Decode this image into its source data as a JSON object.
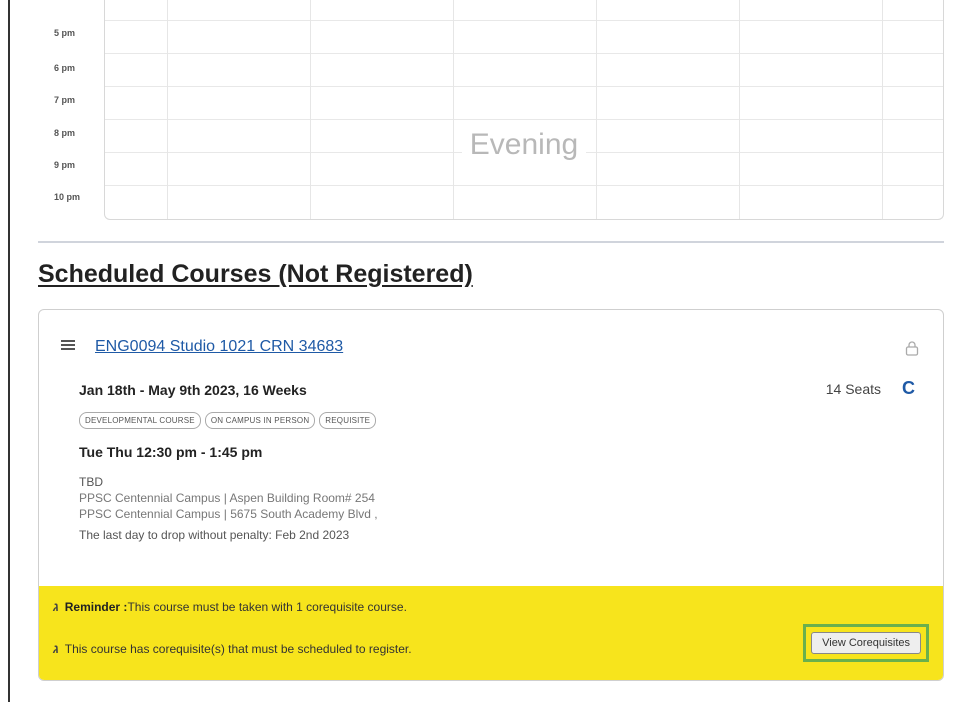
{
  "calendar": {
    "time_labels": [
      "5 pm",
      "6 pm",
      "7 pm",
      "8 pm",
      "9 pm",
      "10 pm"
    ],
    "block_label": "Evening"
  },
  "section": {
    "title": "Scheduled Courses (Not Registered)"
  },
  "course": {
    "link_text": "ENG0094 Studio 1021 CRN 34683",
    "dates": "Jan 18th - May 9th 2023, 16 Weeks",
    "seats": "14 Seats",
    "tags": [
      "Developmental Course",
      "On Campus In Person",
      "Requisite"
    ],
    "meeting": "Tue Thu 12:30 pm - 1:45 pm",
    "instructor": "TBD",
    "location_room": "PPSC Centennial Campus | Aspen Building Room# 254",
    "location_address": "PPSC Centennial Campus | 5675 South Academy Blvd ,",
    "drop_note": "The last day to drop without penalty: Feb 2nd 2023",
    "icons": {
      "menu": "hamburger-icon",
      "lock": "lock-icon",
      "refresh": "refresh-icon",
      "leaf": "leaf-icon"
    }
  },
  "notices": {
    "reminder_label": "Reminder :",
    "reminder_text": "This course must be taken with 1 corequisite course.",
    "coreq_text": "This course has corequisite(s) that must be scheduled to register.",
    "button_label": "View Corequisites"
  },
  "colors": {
    "link": "#1f5aa6",
    "notice_bg": "#f7e41c",
    "highlight_border": "#6ab04c"
  }
}
